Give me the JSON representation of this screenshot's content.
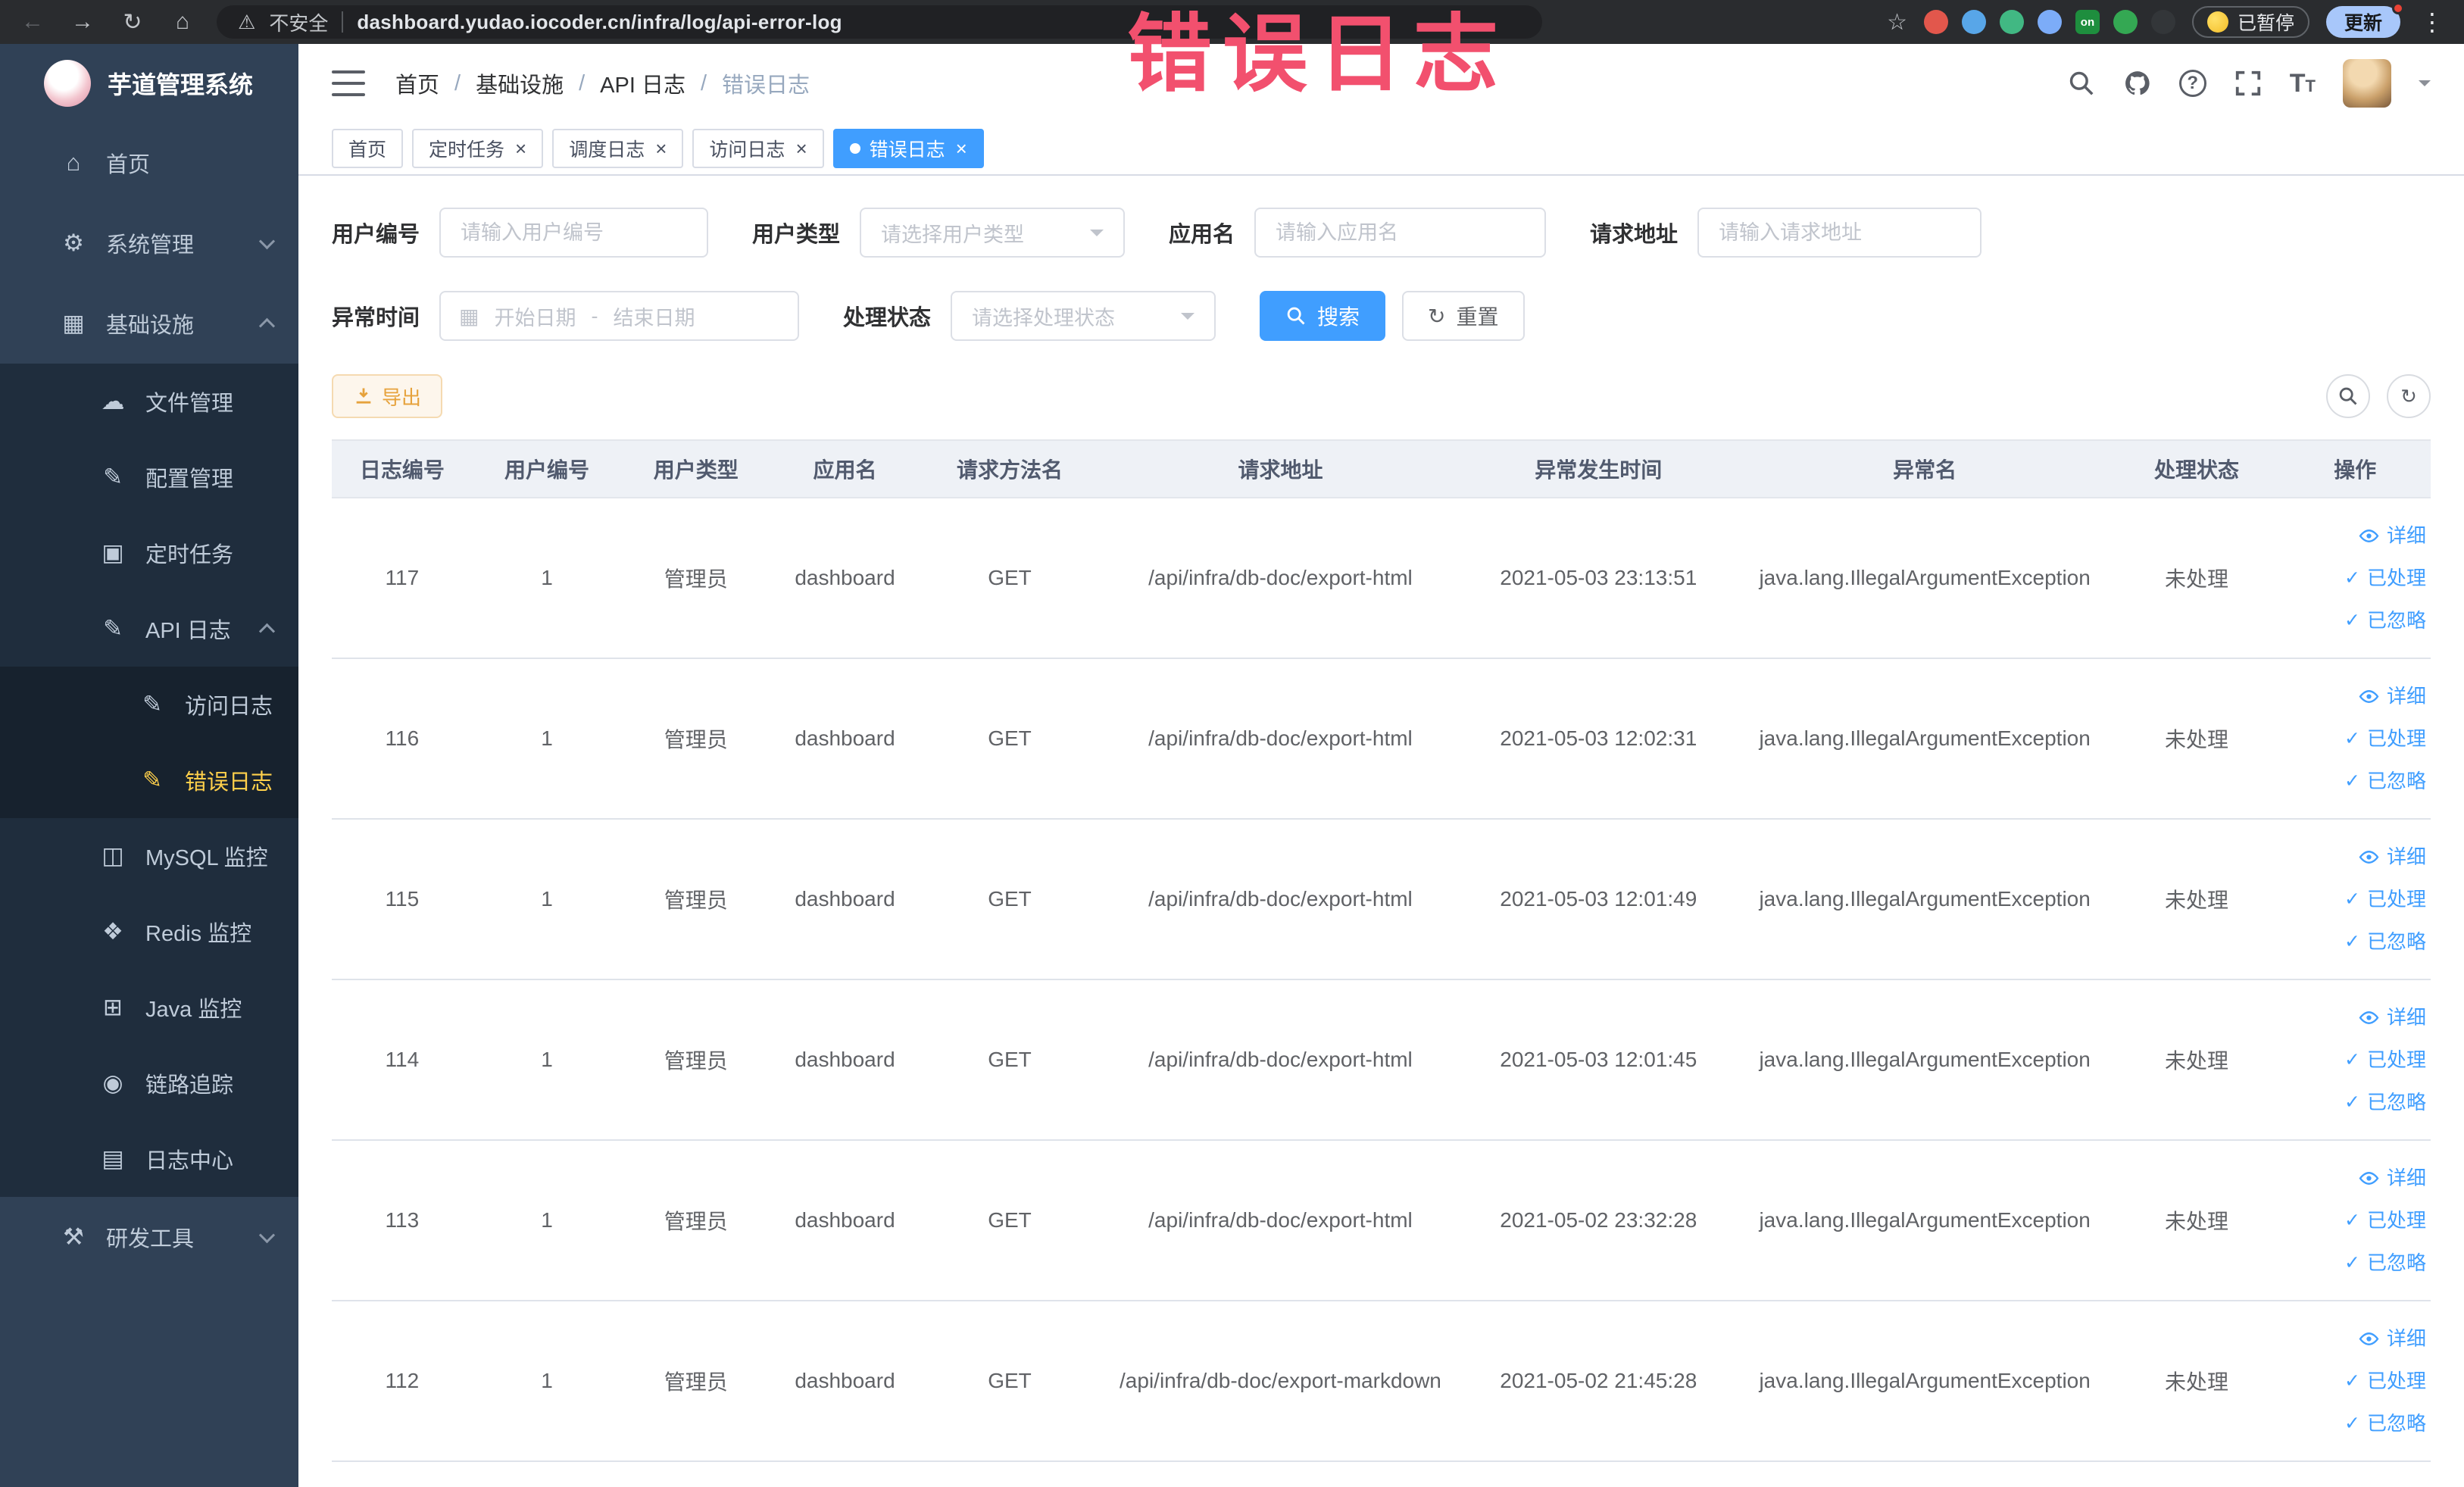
{
  "colors": {
    "accent": "#409eff",
    "sidebar_active": "#ffd04b",
    "warning_text": "#e6a23c",
    "annotation": "#f2506e"
  },
  "annotation": {
    "text": "错误日志"
  },
  "browser": {
    "security_label": "不安全",
    "url": "dashboard.yudao.iocoder.cn/infra/log/api-error-log",
    "paused_label": "已暂停",
    "update_label": "更新",
    "extensions": [
      {
        "name": "extension-icon-red",
        "color": "#e2574c",
        "text": "",
        "square": false
      },
      {
        "name": "extension-icon-pin",
        "color": "#58a6e8",
        "text": "",
        "square": false
      },
      {
        "name": "extension-icon-vue",
        "color": "#41b883",
        "text": "",
        "square": false
      },
      {
        "name": "extension-icon-puzzle",
        "color": "#7cacf8",
        "text": "",
        "square": false
      },
      {
        "name": "extension-icon-on-badge",
        "color": "#1e8e3e",
        "text": "on",
        "square": true
      },
      {
        "name": "extension-icon-leaf",
        "color": "#34a853",
        "text": "",
        "square": false
      },
      {
        "name": "extension-icon-plug",
        "color": "#333639",
        "text": "",
        "square": false
      }
    ]
  },
  "sidebar": {
    "title": "芋道管理系统",
    "items": [
      {
        "key": "home",
        "icon": "home",
        "label": "首页",
        "level": 1,
        "chevron": null,
        "active": false
      },
      {
        "key": "system-management",
        "icon": "gear",
        "label": "系统管理",
        "level": 1,
        "chevron": "down",
        "active": false
      },
      {
        "key": "infrastructure",
        "icon": "grid",
        "label": "基础设施",
        "level": 1,
        "chevron": "up",
        "active": false
      },
      {
        "key": "file-management",
        "icon": "cloud",
        "label": "文件管理",
        "level": 2,
        "chevron": null,
        "active": false
      },
      {
        "key": "config-management",
        "icon": "edit",
        "label": "配置管理",
        "level": 2,
        "chevron": null,
        "active": false
      },
      {
        "key": "scheduled-tasks",
        "icon": "task",
        "label": "定时任务",
        "level": 2,
        "chevron": null,
        "active": false
      },
      {
        "key": "api-logs",
        "icon": "docedit",
        "label": "API 日志",
        "level": 2,
        "chevron": "up",
        "active": false
      },
      {
        "key": "access-log",
        "icon": "docedit",
        "label": "访问日志",
        "level": 3,
        "chevron": null,
        "active": false
      },
      {
        "key": "error-log",
        "icon": "docedit",
        "label": "错误日志",
        "level": 3,
        "chevron": null,
        "active": true
      },
      {
        "key": "mysql-monitor",
        "icon": "db",
        "label": "MySQL 监控",
        "level": 2,
        "chevron": null,
        "active": false
      },
      {
        "key": "redis-monitor",
        "icon": "redis",
        "label": "Redis 监控",
        "level": 2,
        "chevron": null,
        "active": false
      },
      {
        "key": "java-monitor",
        "icon": "java",
        "label": "Java 监控",
        "level": 2,
        "chevron": null,
        "active": false
      },
      {
        "key": "tracing",
        "icon": "eye",
        "label": "链路追踪",
        "level": 2,
        "chevron": null,
        "active": false
      },
      {
        "key": "log-center",
        "icon": "log",
        "label": "日志中心",
        "level": 2,
        "chevron": null,
        "active": false
      },
      {
        "key": "dev-tools",
        "icon": "tools",
        "label": "研发工具",
        "level": 1,
        "chevron": "down",
        "active": false
      }
    ]
  },
  "header": {
    "breadcrumb": [
      "首页",
      "基础设施",
      "API 日志",
      "错误日志"
    ]
  },
  "tabs": [
    {
      "key": "home",
      "label": "首页",
      "closable": false,
      "active": false
    },
    {
      "key": "scheduled-tasks",
      "label": "定时任务",
      "closable": true,
      "active": false
    },
    {
      "key": "schedule-log",
      "label": "调度日志",
      "closable": true,
      "active": false
    },
    {
      "key": "access-log",
      "label": "访问日志",
      "closable": true,
      "active": false
    },
    {
      "key": "error-log",
      "label": "错误日志",
      "closable": true,
      "active": true
    }
  ],
  "filters": {
    "user_id": {
      "label": "用户编号",
      "placeholder": "请输入用户编号"
    },
    "user_type": {
      "label": "用户类型",
      "placeholder": "请选择用户类型"
    },
    "app_name": {
      "label": "应用名",
      "placeholder": "请输入应用名"
    },
    "request_url": {
      "label": "请求地址",
      "placeholder": "请输入请求地址"
    },
    "exception_time": {
      "label": "异常时间",
      "start_placeholder": "开始日期",
      "separator": "-",
      "end_placeholder": "结束日期"
    },
    "process_status": {
      "label": "处理状态",
      "placeholder": "请选择处理状态"
    },
    "search_label": "搜索",
    "reset_label": "重置"
  },
  "toolbar": {
    "export_label": "导出"
  },
  "table": {
    "columns": [
      "日志编号",
      "用户编号",
      "用户类型",
      "应用名",
      "请求方法名",
      "请求地址",
      "异常发生时间",
      "异常名",
      "处理状态",
      "操作"
    ],
    "action_labels": [
      "详细",
      "已处理",
      "已忽略"
    ],
    "rows": [
      {
        "id": "117",
        "user_id": "1",
        "user_type": "管理员",
        "app": "dashboard",
        "method": "GET",
        "url": "/api/infra/db-doc/export-html",
        "time": "2021-05-03 23:13:51",
        "exception": "java.lang.IllegalArgumentException",
        "status": "未处理"
      },
      {
        "id": "116",
        "user_id": "1",
        "user_type": "管理员",
        "app": "dashboard",
        "method": "GET",
        "url": "/api/infra/db-doc/export-html",
        "time": "2021-05-03 12:02:31",
        "exception": "java.lang.IllegalArgumentException",
        "status": "未处理"
      },
      {
        "id": "115",
        "user_id": "1",
        "user_type": "管理员",
        "app": "dashboard",
        "method": "GET",
        "url": "/api/infra/db-doc/export-html",
        "time": "2021-05-03 12:01:49",
        "exception": "java.lang.IllegalArgumentException",
        "status": "未处理"
      },
      {
        "id": "114",
        "user_id": "1",
        "user_type": "管理员",
        "app": "dashboard",
        "method": "GET",
        "url": "/api/infra/db-doc/export-html",
        "time": "2021-05-03 12:01:45",
        "exception": "java.lang.IllegalArgumentException",
        "status": "未处理"
      },
      {
        "id": "113",
        "user_id": "1",
        "user_type": "管理员",
        "app": "dashboard",
        "method": "GET",
        "url": "/api/infra/db-doc/export-html",
        "time": "2021-05-02 23:32:28",
        "exception": "java.lang.IllegalArgumentException",
        "status": "未处理"
      },
      {
        "id": "112",
        "user_id": "1",
        "user_type": "管理员",
        "app": "dashboard",
        "method": "GET",
        "url": "/api/infra/db-doc/export-markdown",
        "time": "2021-05-02 21:45:28",
        "exception": "java.lang.IllegalArgumentException",
        "status": "未处理"
      }
    ]
  }
}
